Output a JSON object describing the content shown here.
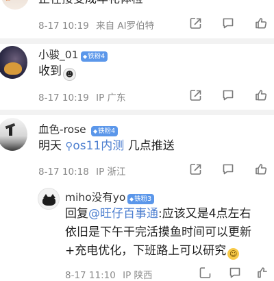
{
  "colors": {
    "link": "#4a7dcf",
    "badge": "#5b97ea",
    "meta": "#8a8a8a",
    "divider": "#f2f2f2"
  },
  "post0": {
    "text_tail": "正在接受成年礼体检",
    "time": "8-17 10:19",
    "source": "来自 AI罗伯特",
    "icons": [
      "share-icon",
      "comment-icon",
      "like-icon"
    ]
  },
  "comment1": {
    "username": "小骏_01",
    "badge": "铁粉4",
    "text": "收到",
    "time": "8-17 10:19",
    "location": "IP 广东"
  },
  "comment2": {
    "username": "血色-rose",
    "badge": "铁粉4",
    "text_pre": "明天 ",
    "search_link": "os11内测",
    "text_post": " 几点推送",
    "time": "8-17 10:18",
    "location": "IP 浙江"
  },
  "reply": {
    "username": "miho没有yo",
    "badge": "铁粉3",
    "prefix": "回复",
    "mention": "@旺仔百事通",
    "line1_rest": ":应该又是4点左右",
    "line2": "依旧是下午干完活摸鱼时间可以更新",
    "line3": "+充电优化，下班路上可以研究",
    "time": "8-17 11:10",
    "location": "IP 陕西"
  }
}
